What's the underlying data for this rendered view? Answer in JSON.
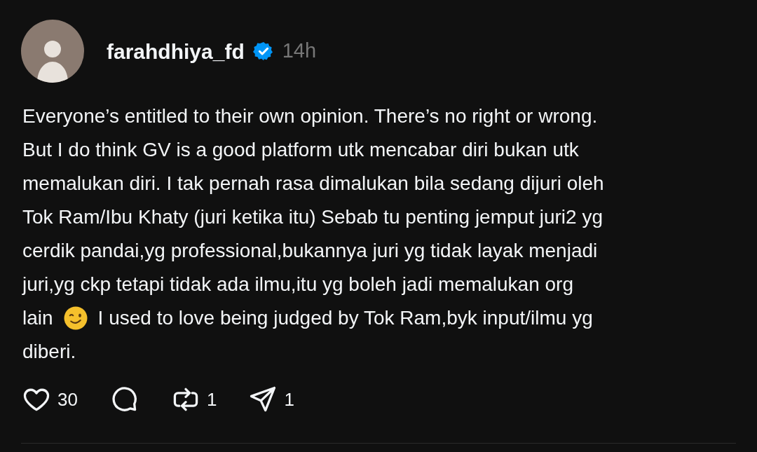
{
  "post": {
    "username": "farahdhiya_fd",
    "verified": true,
    "time": "14h",
    "lines": [
      {
        "kind": "text",
        "text": "Everyone’s entitled to their own opinion. There’s no right or wrong."
      },
      {
        "kind": "text",
        "text": "But I do think GV is a good platform utk mencabar diri bukan utk"
      },
      {
        "kind": "text",
        "text": "memalukan diri. I tak pernah rasa dimalukan bila sedang dijuri oleh"
      },
      {
        "kind": "text",
        "text": "Tok Ram/Ibu Khaty (juri ketika itu) Sebab tu penting jemput juri2 yg"
      },
      {
        "kind": "text",
        "text": "cerdik pandai,yg professional,bukannya juri yg tidak layak menjadi"
      },
      {
        "kind": "text",
        "text": "juri,yg ckp tetapi tidak ada ilmu,itu yg boleh jadi memalukan org"
      },
      {
        "kind": "emoji",
        "before": "lain",
        "after": "I used to love being judged by Tok Ram,byk input/ilmu yg"
      },
      {
        "kind": "text",
        "text": "diberi."
      }
    ],
    "actions": [
      {
        "kind": "like",
        "count": "30"
      },
      {
        "kind": "reply"
      },
      {
        "kind": "repost",
        "count": "1"
      },
      {
        "kind": "share",
        "count": "1"
      }
    ]
  }
}
